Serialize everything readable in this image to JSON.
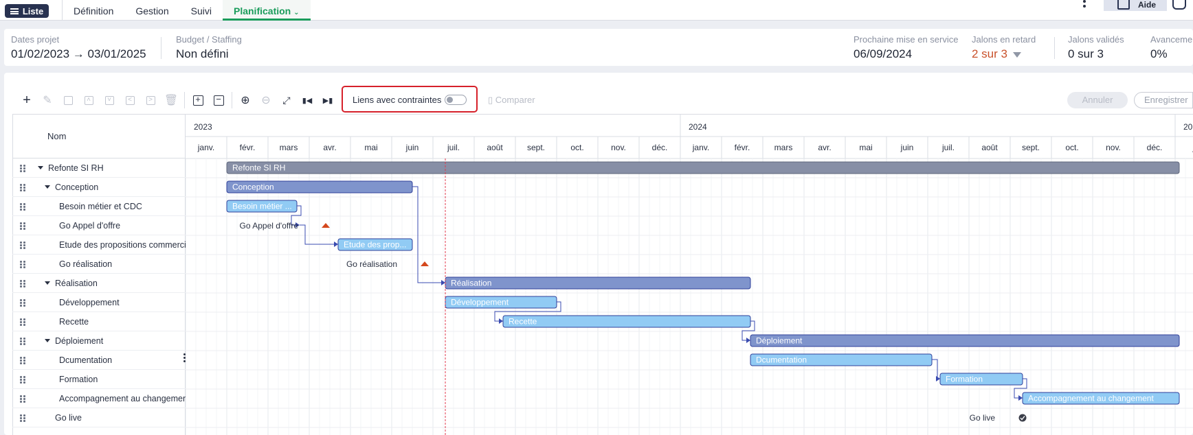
{
  "topbar": {
    "list_label": "Liste",
    "tabs": [
      {
        "label": "Définition",
        "active": false
      },
      {
        "label": "Gestion",
        "active": false
      },
      {
        "label": "Suivi",
        "active": false
      },
      {
        "label": "Planification",
        "active": true
      }
    ],
    "help_label": "Aide"
  },
  "summary": {
    "dates": {
      "label": "Dates projet",
      "value": "01/02/2023 → 03/01/2025"
    },
    "budget": {
      "label": "Budget / Staffing",
      "value": "Non défini"
    },
    "next_release": {
      "label": "Prochaine mise en service",
      "value": "06/09/2024"
    },
    "late": {
      "label": "Jalons en retard",
      "value": "2 sur 3"
    },
    "validated": {
      "label": "Jalons validés",
      "value": "0 sur 3"
    },
    "progress": {
      "label": "Avancement",
      "value": "0%"
    }
  },
  "toolbar": {
    "links_label": "Liens avec contraintes",
    "links_enabled": false,
    "compare_label": "Comparer",
    "cancel_label": "Annuler",
    "save_label": "Enregistrer"
  },
  "grid": {
    "name_header": "Nom",
    "years": [
      {
        "label": "2023",
        "start": 0
      },
      {
        "label": "2024",
        "start": 12
      },
      {
        "label": "20",
        "start": 24
      }
    ],
    "months": [
      "janv.",
      "févr.",
      "mars",
      "avr.",
      "mai",
      "juin",
      "juil.",
      "août",
      "sept.",
      "oct.",
      "nov.",
      "déc.",
      "janv.",
      "févr.",
      "mars",
      "avr.",
      "mai",
      "juin",
      "juil.",
      "août",
      "sept.",
      "oct.",
      "nov.",
      "déc.",
      "ja"
    ],
    "today_month": 6.3,
    "rows": [
      {
        "name": "Refonte SI RH",
        "level": 0,
        "group": true
      },
      {
        "name": "Conception",
        "level": 1,
        "group": true
      },
      {
        "name": "Besoin métier et CDC",
        "level": 2,
        "group": false
      },
      {
        "name": "Go Appel d'offre",
        "level": 2,
        "group": false
      },
      {
        "name": "Etude des propositions commerciales",
        "level": 2,
        "group": false
      },
      {
        "name": "Go réalisation",
        "level": 2,
        "group": false
      },
      {
        "name": "Réalisation",
        "level": 1,
        "group": true
      },
      {
        "name": "Développement",
        "level": 2,
        "group": false
      },
      {
        "name": "Recette",
        "level": 2,
        "group": false
      },
      {
        "name": "Déploiement",
        "level": 1,
        "group": true
      },
      {
        "name": "Dcumentation",
        "level": 2,
        "group": false
      },
      {
        "name": "Formation",
        "level": 2,
        "group": false
      },
      {
        "name": "Accompagnement au changement",
        "level": 2,
        "group": false
      },
      {
        "name": "Go live",
        "level": 1,
        "group": false
      }
    ],
    "bars": [
      {
        "row": 0,
        "label": "Refonte SI RH",
        "start": 1.0,
        "end": 24.1,
        "kind": "summary"
      },
      {
        "row": 1,
        "label": "Conception",
        "start": 1.0,
        "end": 5.5,
        "kind": "group"
      },
      {
        "row": 2,
        "label": "Besoin métier ...",
        "start": 1.0,
        "end": 2.7,
        "kind": "task"
      },
      {
        "row": 4,
        "label": "Etude des prop...",
        "start": 3.7,
        "end": 5.5,
        "kind": "task"
      },
      {
        "row": 6,
        "label": "Réalisation",
        "start": 6.3,
        "end": 13.7,
        "kind": "group"
      },
      {
        "row": 7,
        "label": "Développement",
        "start": 6.3,
        "end": 9.0,
        "kind": "task"
      },
      {
        "row": 8,
        "label": "Recette",
        "start": 7.7,
        "end": 13.7,
        "kind": "task"
      },
      {
        "row": 9,
        "label": "Déploiement",
        "start": 13.7,
        "end": 24.1,
        "kind": "group"
      },
      {
        "row": 10,
        "label": "Dcumentation",
        "start": 13.7,
        "end": 18.1,
        "kind": "task"
      },
      {
        "row": 11,
        "label": "Formation",
        "start": 18.3,
        "end": 20.3,
        "kind": "task"
      },
      {
        "row": 12,
        "label": "Accompagnement au changement",
        "start": 20.3,
        "end": 24.1,
        "kind": "task"
      }
    ],
    "milestones": [
      {
        "row": 3,
        "label": "Go Appel d'offre",
        "at": 3.1,
        "status": "late"
      },
      {
        "row": 5,
        "label": "Go réalisation",
        "at": 5.5,
        "status": "late"
      },
      {
        "row": 13,
        "label": "Go live",
        "at": 20.0,
        "status": "done"
      }
    ],
    "links": [
      {
        "from": 1,
        "to": 6
      },
      {
        "from": 2,
        "to": 3
      },
      {
        "from": 3,
        "to": 4
      },
      {
        "from": 7,
        "to": 8
      },
      {
        "from": 8,
        "to": 9
      },
      {
        "from": 10,
        "to": 11
      },
      {
        "from": 11,
        "to": 12
      }
    ],
    "colors": {
      "summary": "#878fa6",
      "group": "#7f94cc",
      "task": "#91cbf4",
      "border": "#2f3f9a",
      "late": "#d4481d",
      "today": "#e03a4c",
      "link": "#3a4bb0"
    }
  }
}
